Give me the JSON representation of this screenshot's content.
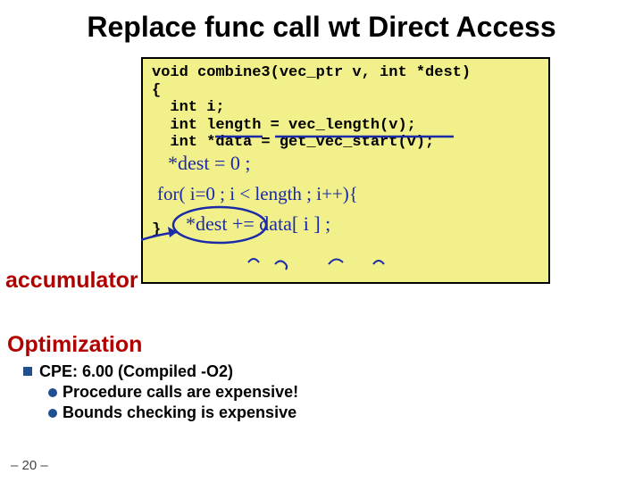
{
  "title": "Replace func call wt Direct Access",
  "code": {
    "line1": "void combine3(vec_ptr v, int *dest)",
    "line2": "{",
    "line3": "  int i;",
    "line4": "  int length = vec_length(v);",
    "line5": "  int *data = get_vec_start(v);",
    "closebrace": "}"
  },
  "handwriting": {
    "line_a": "*dest = 0;",
    "line_b": "for(i=0; i<length; i++){",
    "line_c": "  *dest += data[i];"
  },
  "labels": {
    "accumulator": "accumulator"
  },
  "section": {
    "heading": "Optimization",
    "bullet1_prefix": "CPE:   ",
    "bullet1_rest": "6.00 (Compiled -O2)",
    "sub1": "Procedure calls are expensive!",
    "sub2": "Bounds checking is expensive"
  },
  "footer": "– 20 –"
}
